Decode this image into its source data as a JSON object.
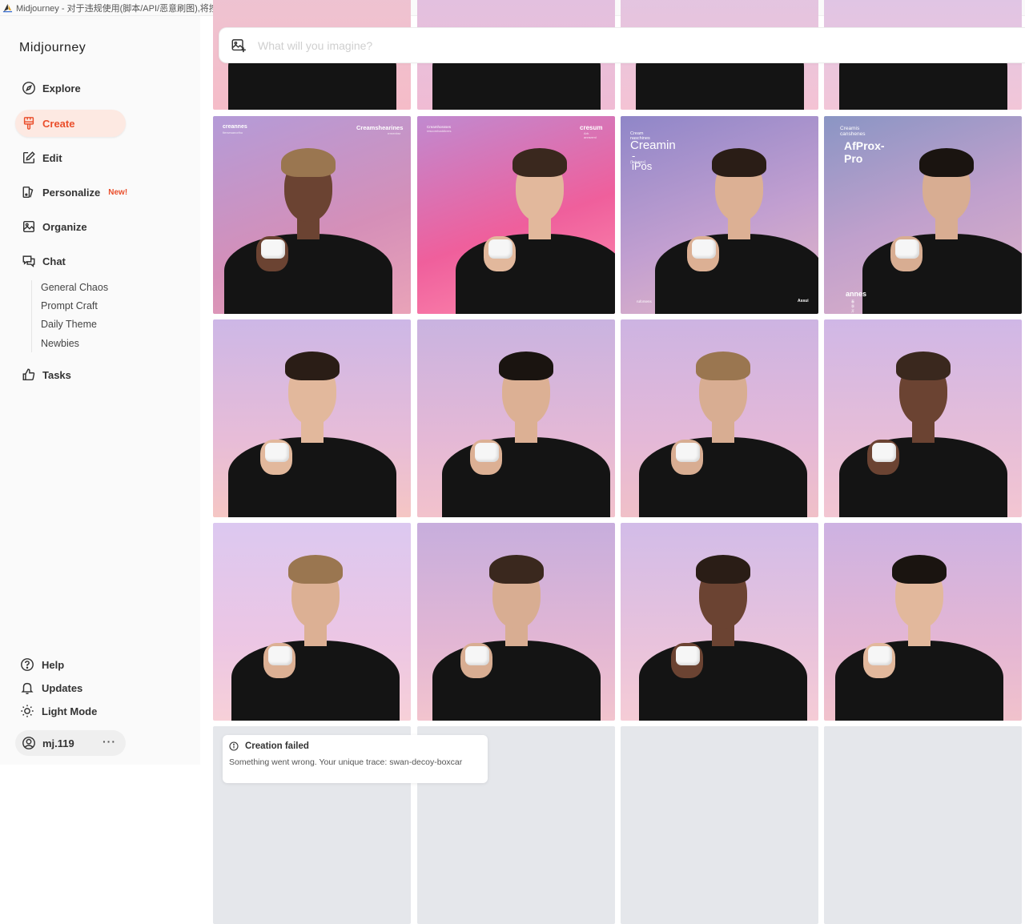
{
  "window": {
    "title": "Midjourney - 对于违规使用(脚本/API/恶意刷图),将按官方要求做清退封号.Tip:双击这里放大窗口"
  },
  "sidebar": {
    "brand": "Midjourney",
    "nav": [
      {
        "label": "Explore",
        "icon": "compass-icon"
      },
      {
        "label": "Create",
        "icon": "paintbrush-icon",
        "active": true
      },
      {
        "label": "Edit",
        "icon": "edit-icon"
      },
      {
        "label": "Personalize",
        "icon": "personalize-icon",
        "badge": "New!"
      },
      {
        "label": "Organize",
        "icon": "image-gallery-icon"
      },
      {
        "label": "Chat",
        "icon": "chat-icon"
      }
    ],
    "chat_rooms": [
      "General Chaos",
      "Prompt Craft",
      "Daily Theme",
      "Newbies"
    ],
    "tasks": {
      "label": "Tasks",
      "icon": "thumbs-up-icon"
    },
    "footer": [
      {
        "label": "Help",
        "icon": "help-icon"
      },
      {
        "label": "Updates",
        "icon": "bell-icon"
      },
      {
        "label": "Light Mode",
        "icon": "sun-icon"
      }
    ],
    "user": {
      "name": "mj.119",
      "menu": "···"
    }
  },
  "search": {
    "placeholder": "What will you imagine?",
    "value": ""
  },
  "posters": {
    "r1c1": {
      "brand_left": "creannes",
      "brand_left_sub": "fiersesanoriho",
      "brand_right": "Creamshearines",
      "brand_right_sub": "rrrnenhsr"
    },
    "r1c2": {
      "brand_left": "Creamhossses",
      "brand_left_sub": "rescomhaddicres",
      "brand_right": "cresum",
      "brand_right_sub": "Arh. annsrrrnl"
    },
    "r1c3": {
      "kicker": "Cream naschines",
      "headline": "Creamin",
      "headline2": "-iPos",
      "sub": "(fainnes)",
      "footer_left": "ruforsens",
      "footer_right": "Assui"
    },
    "r1c4": {
      "kicker": "Creamis",
      "kicker2": "canshenes",
      "headline": "AfProx-Pro",
      "footer_brand": "annes",
      "footer_sub": "春季开启"
    }
  },
  "status": {
    "title": "Creation failed",
    "message": "Something went wrong. Your unique trace: swan-decoy-boxcar"
  }
}
